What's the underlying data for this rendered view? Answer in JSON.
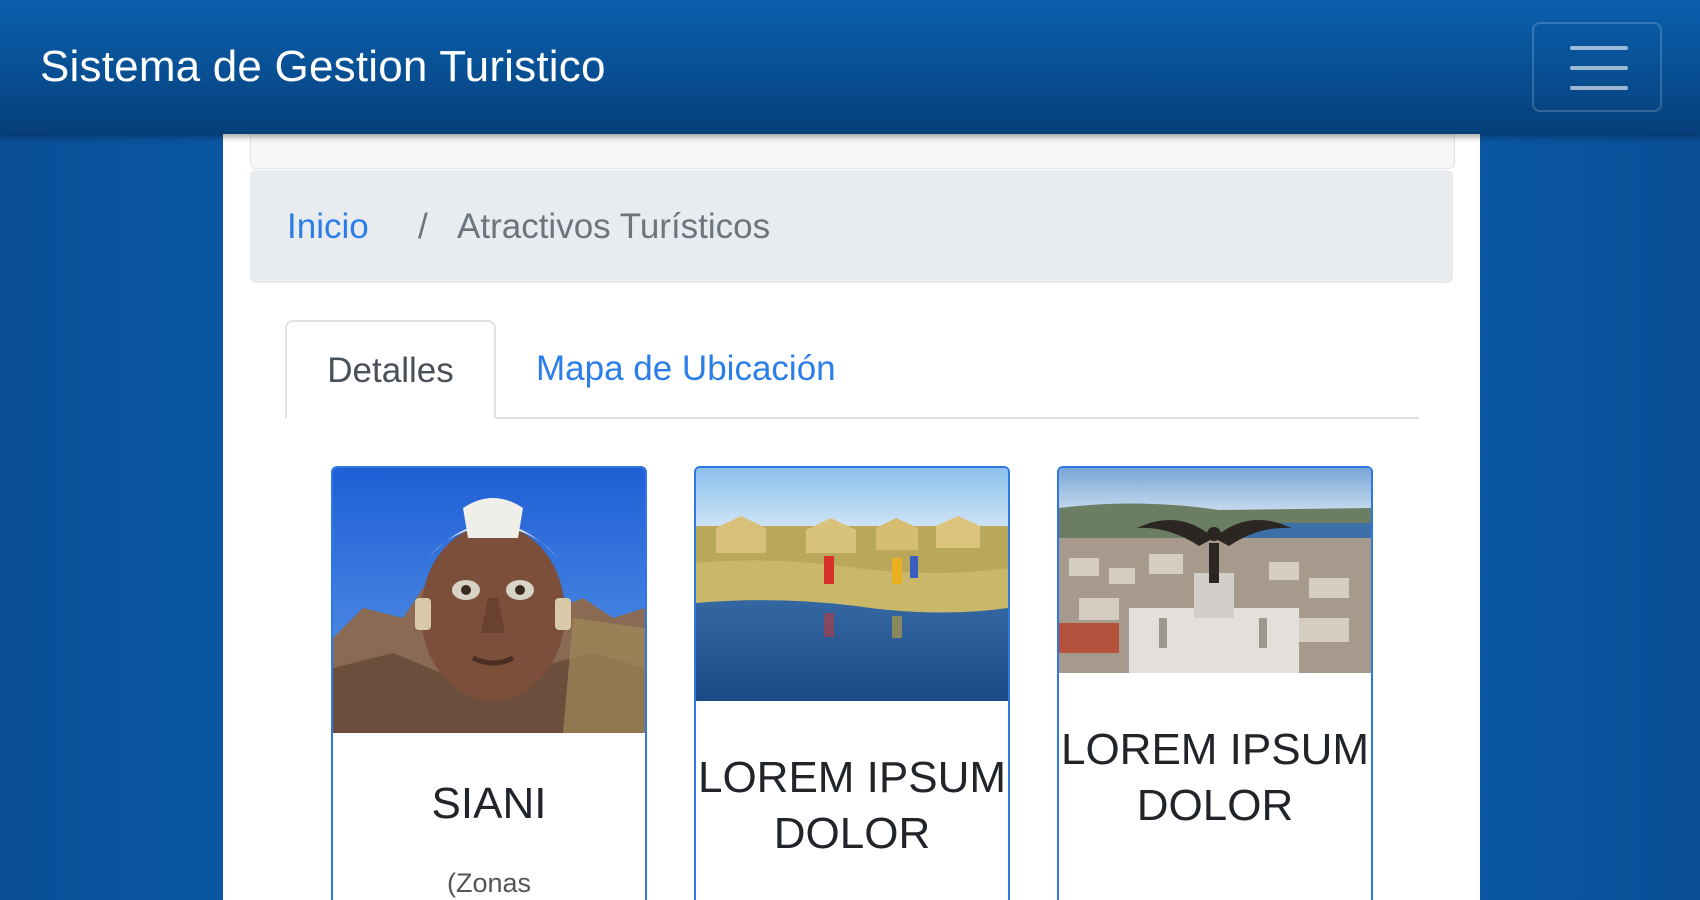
{
  "header": {
    "brand": "Sistema de Gestion Turistico",
    "menu_icon": "hamburger-menu-icon"
  },
  "breadcrumb": {
    "home": "Inicio",
    "separator": "/",
    "current": "Atractivos Turísticos"
  },
  "tabs": [
    {
      "label": "Detalles",
      "active": true
    },
    {
      "label": "Mapa de Ubicación",
      "active": false
    }
  ],
  "cards": [
    {
      "title": "SIANI",
      "subtitle": "(Zonas"
    },
    {
      "title": "LOREM IPSUM DOLOR"
    },
    {
      "title": "LOREM IPSUM DOLOR"
    }
  ],
  "colors": {
    "navbar": "#0858a3",
    "link": "#2b7de9",
    "card_border": "#2f78e0",
    "breadcrumb_bg": "#e9ecef"
  }
}
